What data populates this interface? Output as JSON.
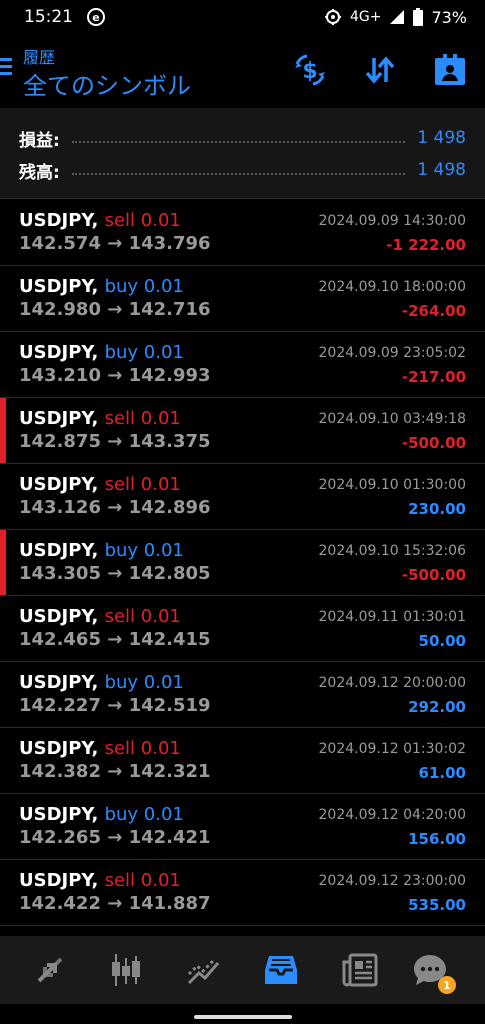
{
  "status": {
    "time": "15:21",
    "network": "4G+",
    "battery": "73%"
  },
  "header": {
    "subtitle": "履歴",
    "title": "全てのシンボル"
  },
  "summary": [
    {
      "label": "損益:",
      "value": "1 498"
    },
    {
      "label": "残高:",
      "value": "1 498"
    }
  ],
  "deals": [
    {
      "symbol": "USDJPY,",
      "type": "sell",
      "volume": "0.01",
      "prices": "142.574 → 143.796",
      "time": "2024.09.09 14:30:00",
      "profit": "-1 222.00",
      "flag": false
    },
    {
      "symbol": "USDJPY,",
      "type": "buy",
      "volume": "0.01",
      "prices": "142.980 → 142.716",
      "time": "2024.09.10 18:00:00",
      "profit": "-264.00",
      "flag": false
    },
    {
      "symbol": "USDJPY,",
      "type": "buy",
      "volume": "0.01",
      "prices": "143.210 → 142.993",
      "time": "2024.09.09 23:05:02",
      "profit": "-217.00",
      "flag": false
    },
    {
      "symbol": "USDJPY,",
      "type": "sell",
      "volume": "0.01",
      "prices": "142.875 → 143.375",
      "time": "2024.09.10 03:49:18",
      "profit": "-500.00",
      "flag": true
    },
    {
      "symbol": "USDJPY,",
      "type": "sell",
      "volume": "0.01",
      "prices": "143.126 → 142.896",
      "time": "2024.09.10 01:30:00",
      "profit": "230.00",
      "flag": false
    },
    {
      "symbol": "USDJPY,",
      "type": "buy",
      "volume": "0.01",
      "prices": "143.305 → 142.805",
      "time": "2024.09.10 15:32:06",
      "profit": "-500.00",
      "flag": true
    },
    {
      "symbol": "USDJPY,",
      "type": "sell",
      "volume": "0.01",
      "prices": "142.465 → 142.415",
      "time": "2024.09.11 01:30:01",
      "profit": "50.00",
      "flag": false
    },
    {
      "symbol": "USDJPY,",
      "type": "buy",
      "volume": "0.01",
      "prices": "142.227 → 142.519",
      "time": "2024.09.12 20:00:00",
      "profit": "292.00",
      "flag": false
    },
    {
      "symbol": "USDJPY,",
      "type": "sell",
      "volume": "0.01",
      "prices": "142.382 → 142.321",
      "time": "2024.09.12 01:30:02",
      "profit": "61.00",
      "flag": false
    },
    {
      "symbol": "USDJPY,",
      "type": "buy",
      "volume": "0.01",
      "prices": "142.265 → 142.421",
      "time": "2024.09.12 04:20:00",
      "profit": "156.00",
      "flag": false
    },
    {
      "symbol": "USDJPY,",
      "type": "sell",
      "volume": "0.01",
      "prices": "142.422 → 141.887",
      "time": "2024.09.12 23:00:00",
      "profit": "535.00",
      "flag": false
    }
  ],
  "nav": {
    "chat_badge": "1"
  },
  "colors": {
    "accent": "#2a8cff",
    "loss": "#e0202a",
    "badge": "#f5a623"
  },
  "icons": [
    "menu-icon",
    "currency-exchange-icon",
    "sort-icon",
    "report-icon",
    "quotes-icon",
    "chart-icon",
    "trade-icon",
    "history-icon",
    "news-icon",
    "chat-icon"
  ]
}
